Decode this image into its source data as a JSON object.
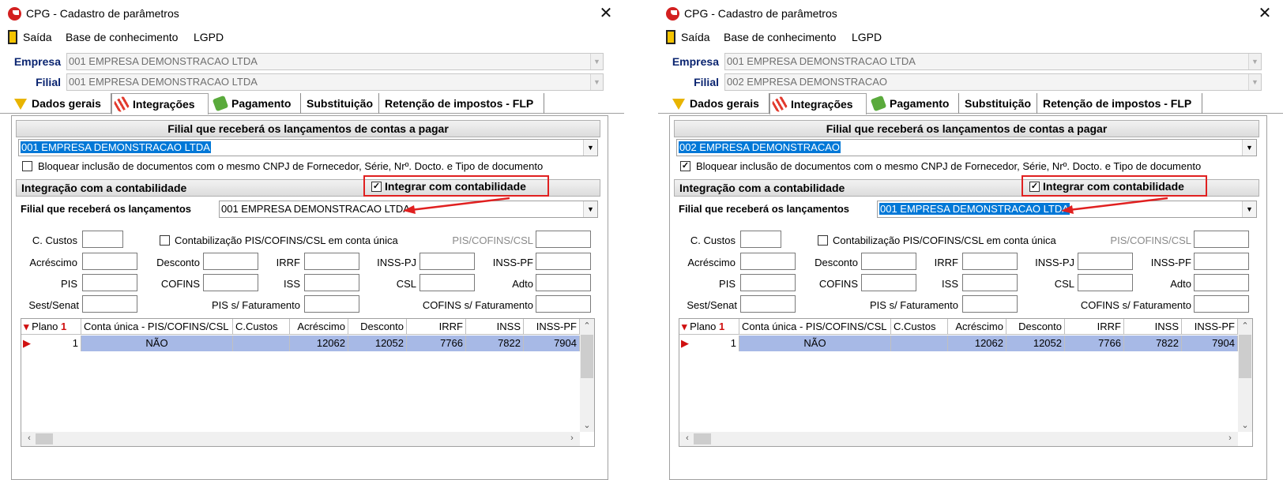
{
  "windows": [
    {
      "title": "CPG - Cadastro de parâmetros",
      "close": "✕",
      "menu": [
        "Saída",
        "Base de conhecimento",
        "LGPD"
      ],
      "empresa_label": "Empresa",
      "empresa_value": "001 EMPRESA DEMONSTRACAO LTDA",
      "filial_label": "Filial",
      "filial_value": "001 EMPRESA DEMONSTRACAO LTDA",
      "tabs": [
        "Dados gerais",
        "Integrações",
        "Pagamento",
        "Substituição",
        "Retenção de impostos - FLP"
      ],
      "section1_title": "Filial que receberá os lançamentos de contas a pagar",
      "filial_contas_value": "001 EMPRESA DEMONSTRACAO LTDA",
      "bloquear_checked": "",
      "bloquear_label": "Bloquear inclusão de documentos com o mesmo CNPJ de Fornecedor, Série, Nrº. Docto. e Tipo de documento",
      "section2_title": "Integração com a contabilidade",
      "integrar_checked": "✓",
      "integrar_label": "Integrar com contabilidade",
      "filial_lanc_label": "Filial que receberá os lançamentos",
      "filial_lanc_value": "001 EMPRESA DEMONSTRACAO LTDA",
      "filial_lanc_selected": "false"
    },
    {
      "title": "CPG - Cadastro de parâmetros",
      "close": "✕",
      "menu": [
        "Saída",
        "Base de conhecimento",
        "LGPD"
      ],
      "empresa_label": "Empresa",
      "empresa_value": "001 EMPRESA DEMONSTRACAO LTDA",
      "filial_label": "Filial",
      "filial_value": "002 EMPRESA DEMONSTRACAO",
      "tabs": [
        "Dados gerais",
        "Integrações",
        "Pagamento",
        "Substituição",
        "Retenção de impostos - FLP"
      ],
      "section1_title": "Filial que receberá os lançamentos de contas a pagar",
      "filial_contas_value": "002 EMPRESA DEMONSTRACAO",
      "bloquear_checked": "✓",
      "bloquear_label": "Bloquear inclusão de documentos com o mesmo CNPJ de Fornecedor, Série, Nrº. Docto. e Tipo de documento",
      "section2_title": "Integração com a contabilidade",
      "integrar_checked": "✓",
      "integrar_label": "Integrar com contabilidade",
      "filial_lanc_label": "Filial que receberá os lançamentos",
      "filial_lanc_value": "001 EMPRESA DEMONSTRACAO LTDA",
      "filial_lanc_selected": "true"
    }
  ],
  "fields": {
    "c_custos": "C. Custos",
    "contab_label": "Contabilização PIS/COFINS/CSL em conta única",
    "pis_cofins_csl": "PIS/COFINS/CSL",
    "acrescimo": "Acréscimo",
    "desconto": "Desconto",
    "irrf": "IRRF",
    "inss_pj": "INSS-PJ",
    "inss_pf": "INSS-PF",
    "pis": "PIS",
    "cofins": "COFINS",
    "iss": "ISS",
    "csl": "CSL",
    "adto": "Adto",
    "sest_senat": "Sest/Senat",
    "pis_fat": "PIS s/ Faturamento",
    "cofins_fat": "COFINS s/ Faturamento"
  },
  "grid": {
    "columns": [
      "Plano",
      "Conta única - PIS/COFINS/CSL",
      "C.Custos",
      "Acréscimo",
      "Desconto",
      "IRRF",
      "INSS",
      "INSS-PF"
    ],
    "sort_marker": "1",
    "row": [
      "1",
      "NÃO",
      "",
      "12062",
      "12052",
      "7766",
      "7822",
      "7904"
    ]
  },
  "colors": {
    "highlight_red": "#e02020",
    "selected_row": "#a7b9e6",
    "selection_blue": "#0078d7",
    "label_blue": "#0a2470"
  }
}
